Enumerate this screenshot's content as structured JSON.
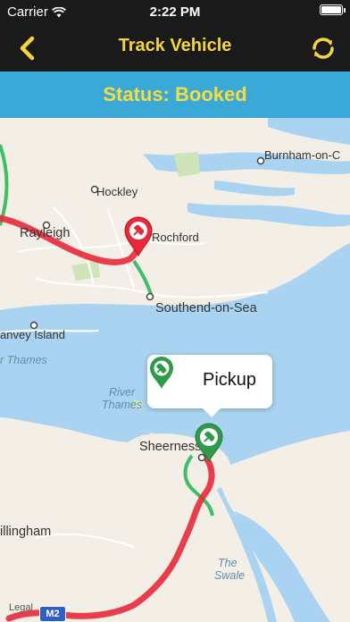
{
  "status_bar": {
    "carrier": "Carrier",
    "time": "2:22 PM",
    "battery_level": 1.0
  },
  "navbar": {
    "title": "Track Vehicle",
    "back_icon": "chevron-left-icon",
    "refresh_icon": "refresh-icon",
    "accent_color": "#f5d63a"
  },
  "status_band": {
    "text": "Status: Booked",
    "background": "#3aa9d8",
    "text_color": "#f7dd3c"
  },
  "map": {
    "places": [
      "Burnham-on-C",
      "Hockley",
      "Rayleigh",
      "Rochford",
      "Southend-on-Sea",
      "anvey Island",
      "r Thames",
      "River",
      "Thames",
      "Sheerness",
      "illingham",
      "The",
      "Swale",
      "Legal"
    ],
    "road_badge": "M2",
    "callout": {
      "label": "Pickup",
      "icon": "pickup-pin-icon"
    },
    "markers": {
      "vehicle": "vehicle-pin-icon",
      "pickup": "pickup-pin-icon"
    },
    "route_color": "#e8293b",
    "motorway_color": "#3dbf6a"
  }
}
